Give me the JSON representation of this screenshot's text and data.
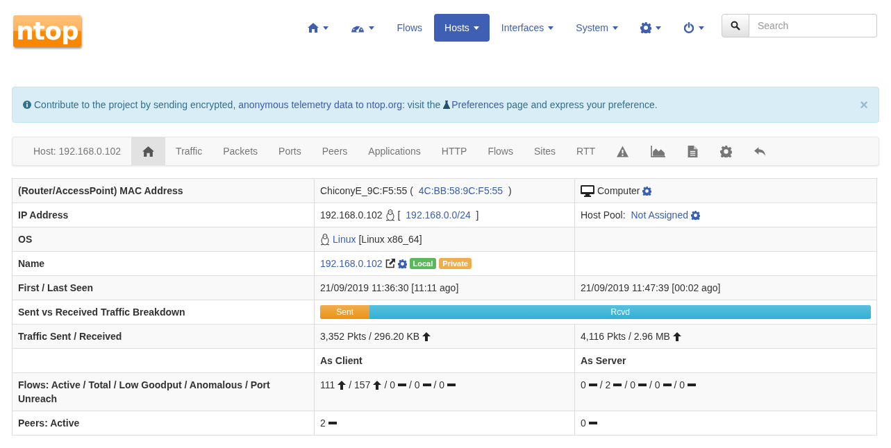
{
  "logo": "ntop",
  "nav": [
    {
      "kind": "home",
      "dropdown": true,
      "selected": false
    },
    {
      "kind": "gauge",
      "dropdown": true,
      "selected": false
    },
    {
      "kind": "text",
      "label": "Flows",
      "dropdown": false,
      "selected": false
    },
    {
      "kind": "text",
      "label": "Hosts",
      "dropdown": true,
      "selected": true
    },
    {
      "kind": "text",
      "label": "Interfaces",
      "dropdown": true,
      "selected": false
    },
    {
      "kind": "text",
      "label": "System",
      "dropdown": true,
      "selected": false
    },
    {
      "kind": "gear",
      "dropdown": true,
      "selected": false
    },
    {
      "kind": "power",
      "dropdown": true,
      "selected": false
    }
  ],
  "search": {
    "placeholder": "Search"
  },
  "alert": {
    "parts": [
      {
        "kind": "text",
        "text": "Contribute to the project by sending encrypted, "
      },
      {
        "kind": "link",
        "text": "anonymous telemetry data to ntop.org"
      },
      {
        "kind": "text",
        "text": ": visit the "
      },
      {
        "kind": "link",
        "text": "Preferences",
        "flask": true
      },
      {
        "kind": "text",
        "text": " page and express your preference."
      }
    ],
    "close": "×"
  },
  "host_tabs": {
    "title": "Host: 192.168.0.102",
    "tabs": [
      {
        "kind": "home",
        "selected": true
      },
      {
        "kind": "text",
        "label": "Traffic",
        "selected": false
      },
      {
        "kind": "text",
        "label": "Packets",
        "selected": false
      },
      {
        "kind": "text",
        "label": "Ports",
        "selected": false
      },
      {
        "kind": "text",
        "label": "Peers",
        "selected": false
      },
      {
        "kind": "text",
        "label": "Applications",
        "selected": false
      },
      {
        "kind": "text",
        "label": "HTTP",
        "selected": false
      },
      {
        "kind": "text",
        "label": "Flows",
        "selected": false
      },
      {
        "kind": "text",
        "label": "Sites",
        "selected": false
      },
      {
        "kind": "text",
        "label": "RTT",
        "selected": false
      },
      {
        "kind": "warning",
        "selected": false
      },
      {
        "kind": "chart",
        "selected": false
      },
      {
        "kind": "document",
        "selected": false
      },
      {
        "kind": "gear",
        "selected": false
      },
      {
        "kind": "back",
        "selected": false
      }
    ]
  },
  "table": {
    "rows": [
      {
        "label": "(Router/AccessPoint) MAC Address",
        "cells": [
          [
            {
              "kind": "text",
              "text": "ChiconyE_9C:F5:55 ( "
            },
            {
              "kind": "link",
              "text": "4C:BB:58:9C:F5:55"
            },
            {
              "kind": "text",
              "text": " )"
            }
          ],
          [
            {
              "kind": "monitor"
            },
            {
              "kind": "text",
              "text": "Computer"
            },
            {
              "kind": "gear"
            }
          ]
        ]
      },
      {
        "label": "IP Address",
        "cells": [
          [
            {
              "kind": "text",
              "text": "192.168.0.102"
            },
            {
              "kind": "linux"
            },
            {
              "kind": "text",
              "text": "[ "
            },
            {
              "kind": "link",
              "text": "192.168.0.0/24"
            },
            {
              "kind": "text",
              "text": " ]"
            }
          ],
          [
            {
              "kind": "text",
              "text": "Host Pool: "
            },
            {
              "kind": "link",
              "text": "Not Assigned"
            },
            {
              "kind": "gear"
            }
          ]
        ]
      },
      {
        "label": "OS",
        "cells": [
          [
            {
              "kind": "linux"
            },
            {
              "kind": "link",
              "text": "Linux"
            },
            {
              "kind": "text",
              "text": "[Linux x86_64]"
            }
          ],
          []
        ]
      },
      {
        "label": "Name",
        "cells": [
          [
            {
              "kind": "link",
              "text": "192.168.0.102"
            },
            {
              "kind": "external"
            },
            {
              "kind": "gear"
            },
            {
              "kind": "badge",
              "text": "Local",
              "color": "#5cb85c"
            },
            {
              "kind": "badge",
              "text": "Private",
              "color": "#f0ad4e"
            }
          ],
          []
        ]
      },
      {
        "label": "First / Last Seen",
        "cells": [
          [
            {
              "kind": "text",
              "text": "21/09/2019 11:36:30 [11:11 ago]"
            }
          ],
          [
            {
              "kind": "text",
              "text": "21/09/2019 11:47:39 [00:02 ago]"
            }
          ]
        ]
      },
      {
        "label": "Sent vs Received Traffic Breakdown",
        "breakdown": {
          "sent": "Sent",
          "rcvd": "Rcvd",
          "level": 0.09
        }
      },
      {
        "label": "Traffic Sent / Received",
        "cells": [
          [
            {
              "kind": "text",
              "text": "3,352 Pkts / 296.20 KB"
            },
            {
              "kind": "trend",
              "up": true
            }
          ],
          [
            {
              "kind": "text",
              "text": "4,116 Pkts / 2.96 MB"
            },
            {
              "kind": "trend",
              "up": true
            }
          ]
        ]
      },
      {
        "label": "",
        "cells": [
          [
            {
              "kind": "heading",
              "text": "As Client"
            }
          ],
          [
            {
              "kind": "heading",
              "text": "As Server"
            }
          ]
        ]
      },
      {
        "label": "Flows: Active / Total / Low Goodput / Anomalous / Port Unreach",
        "cells": [
          [
            {
              "kind": "text",
              "text": "111"
            },
            {
              "kind": "trend",
              "up": true
            },
            {
              "kind": "text",
              "text": "/ 157"
            },
            {
              "kind": "trend",
              "up": true
            },
            {
              "kind": "text",
              "text": "/ 0"
            },
            {
              "kind": "trend",
              "up": false
            },
            {
              "kind": "text",
              "text": "/ 0"
            },
            {
              "kind": "trend",
              "up": false
            },
            {
              "kind": "text",
              "text": "/ 0"
            },
            {
              "kind": "trend",
              "up": false
            }
          ],
          [
            {
              "kind": "text",
              "text": "0"
            },
            {
              "kind": "trend",
              "up": false
            },
            {
              "kind": "text",
              "text": "/ 2"
            },
            {
              "kind": "trend",
              "up": false
            },
            {
              "kind": "text",
              "text": "/ 0"
            },
            {
              "kind": "trend",
              "up": false
            },
            {
              "kind": "text",
              "text": "/ 0"
            },
            {
              "kind": "trend",
              "up": false
            },
            {
              "kind": "text",
              "text": "/ 0"
            },
            {
              "kind": "trend",
              "up": false
            }
          ]
        ]
      },
      {
        "label": "Peers: Active",
        "cells": [
          [
            {
              "kind": "text",
              "text": "2"
            },
            {
              "kind": "trend",
              "up": false
            }
          ],
          [
            {
              "kind": "text",
              "text": "0"
            },
            {
              "kind": "trend",
              "up": false
            }
          ]
        ]
      }
    ]
  }
}
